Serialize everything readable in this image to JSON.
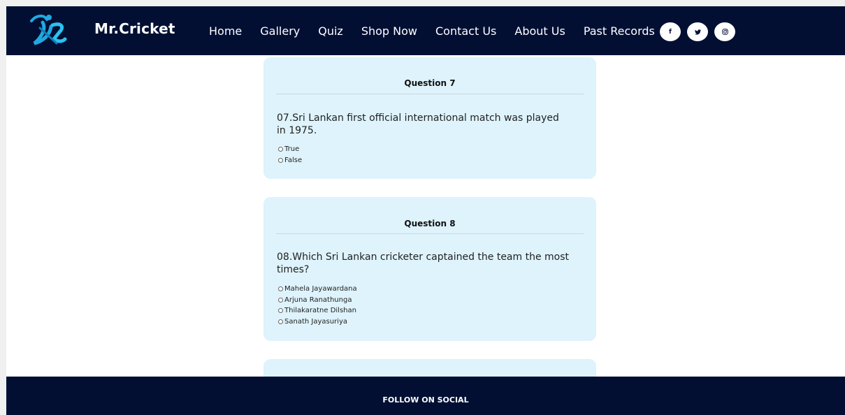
{
  "header": {
    "brand": "Mr.Cricket",
    "nav": [
      "Home",
      "Gallery",
      "Quiz",
      "Shop Now",
      "Contact Us",
      "About Us",
      "Past Records"
    ],
    "socials": [
      "facebook-icon",
      "twitter-icon",
      "instagram-icon"
    ],
    "social_glyphs": [
      "f",
      "",
      ""
    ]
  },
  "quiz": {
    "q7": {
      "title": "Question 7",
      "text": "07.Sri Lankan first official international match was played in 1975.",
      "options": [
        "True",
        "False"
      ]
    },
    "q8": {
      "title": "Question 8",
      "text": "08.Which Sri Lankan cricketer captained the team the most times?",
      "options": [
        "Mahela Jayawardana",
        "Arjuna Ranathunga",
        "Thilakaratne Dilshan",
        "Sanath Jayasuriya"
      ]
    }
  },
  "footer": {
    "title": "FOLLOW ON SOCIAL"
  },
  "colors": {
    "navbar": "#020f33",
    "card": "#def3fb",
    "accent": "#1fa9e1"
  }
}
